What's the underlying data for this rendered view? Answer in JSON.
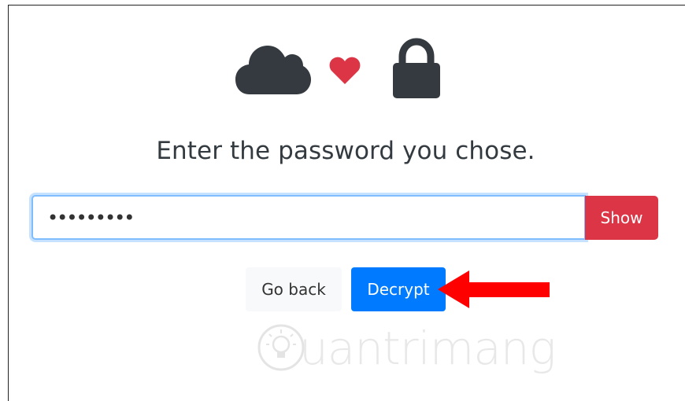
{
  "header": {
    "icons": [
      "cloud-icon",
      "heart-icon",
      "lock-icon"
    ],
    "heart_color": "#dc3545",
    "icon_color": "#343a40"
  },
  "prompt": {
    "text": "Enter the password you chose."
  },
  "password": {
    "value": "•••••••••",
    "show_label": "Show"
  },
  "actions": {
    "go_back_label": "Go back",
    "decrypt_label": "Decrypt",
    "primary_color": "#007bff",
    "danger_color": "#dc3545"
  },
  "annotation": {
    "arrow_color": "#ff0000"
  },
  "watermark": {
    "text": "uantrimang"
  }
}
